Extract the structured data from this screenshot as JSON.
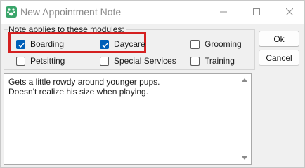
{
  "window": {
    "title": "New Appointment Note",
    "controls": {
      "minimize": "minimize-icon",
      "maximize": "maximize-icon",
      "close": "close-icon"
    }
  },
  "modules": {
    "group_label": "Note applies to these modules:",
    "items": [
      {
        "label": "Boarding",
        "checked": true
      },
      {
        "label": "Daycare",
        "checked": true
      },
      {
        "label": "Grooming",
        "checked": false
      },
      {
        "label": "Petsitting",
        "checked": false
      },
      {
        "label": "Special Services",
        "checked": false
      },
      {
        "label": "Training",
        "checked": false
      }
    ]
  },
  "buttons": {
    "ok": "Ok",
    "cancel": "Cancel"
  },
  "note": {
    "text": "Gets a little rowdy around younger pups.\nDoesn't realize his size when playing."
  },
  "colors": {
    "checkbox_checked": "#005fb8",
    "highlight": "#d42020"
  }
}
